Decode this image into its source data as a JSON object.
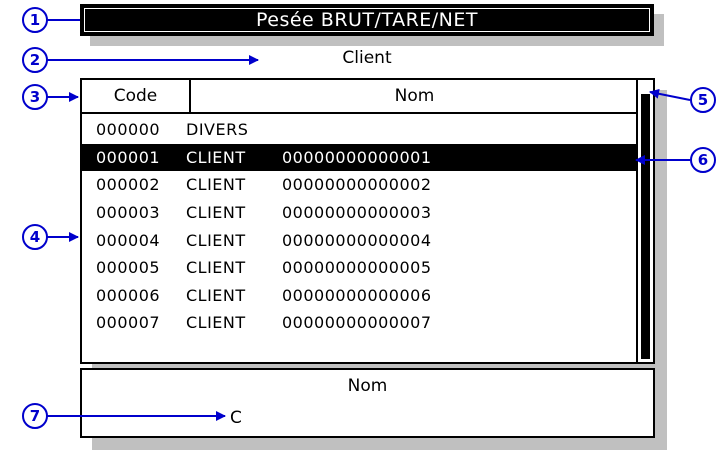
{
  "title": "Pesée BRUT/TARE/NET",
  "subtitle": "Client",
  "list": {
    "headers": {
      "code": "Code",
      "name": "Nom"
    },
    "rows": [
      {
        "code": "000000",
        "label": "DIVERS",
        "number": ""
      },
      {
        "code": "000001",
        "label": "CLIENT",
        "number": "00000000000001"
      },
      {
        "code": "000002",
        "label": "CLIENT",
        "number": "00000000000002"
      },
      {
        "code": "000003",
        "label": "CLIENT",
        "number": "00000000000003"
      },
      {
        "code": "000004",
        "label": "CLIENT",
        "number": "00000000000004"
      },
      {
        "code": "000005",
        "label": "CLIENT",
        "number": "00000000000005"
      },
      {
        "code": "000006",
        "label": "CLIENT",
        "number": "00000000000006"
      },
      {
        "code": "000007",
        "label": "CLIENT",
        "number": "00000000000007"
      }
    ],
    "selected_code": "000001"
  },
  "search": {
    "label": "Nom",
    "value": "C"
  },
  "callouts": [
    "1",
    "2",
    "3",
    "4",
    "5",
    "6",
    "7"
  ],
  "colors": {
    "callout": "#0000cc",
    "selection": "#000000",
    "shadow": "#c0c0c0"
  }
}
